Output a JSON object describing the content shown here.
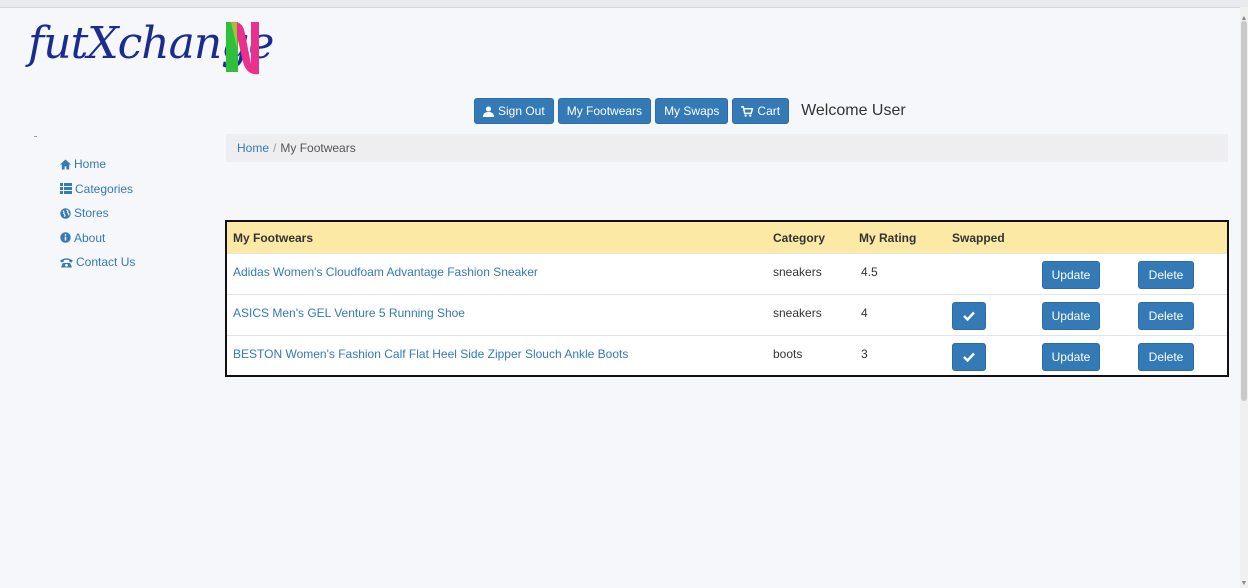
{
  "brand": {
    "logo_text": "futXchange",
    "accent_pink": "#e8308c",
    "accent_green": "#2fbf3a",
    "logo_blue": "#1b2c8f"
  },
  "nav": {
    "sign_out": "Sign Out",
    "my_footwears": "My Footwears",
    "my_swaps": "My Swaps",
    "cart": "Cart",
    "welcome": "Welcome User"
  },
  "sidebar": {
    "items": [
      {
        "label": "Home",
        "icon": "home-icon"
      },
      {
        "label": "Categories",
        "icon": "list-icon"
      },
      {
        "label": "Stores",
        "icon": "globe-icon"
      },
      {
        "label": "About",
        "icon": "info-icon"
      },
      {
        "label": "Contact Us",
        "icon": "phone-icon"
      }
    ]
  },
  "breadcrumb": {
    "home": "Home",
    "separator": "/",
    "current": "My Footwears"
  },
  "table": {
    "headers": {
      "name": "My Footwears",
      "category": "Category",
      "rating": "My Rating",
      "swapped": "Swapped"
    },
    "rows": [
      {
        "name": "Adidas Women's Cloudfoam Advantage Fashion Sneaker",
        "category": "sneakers",
        "rating": "4.5",
        "swapped": false
      },
      {
        "name": "ASICS Men's GEL Venture 5 Running Shoe",
        "category": "sneakers",
        "rating": "4",
        "swapped": true
      },
      {
        "name": "BESTON Women's Fashion Calf Flat Heel Side Zipper Slouch Ankle Boots",
        "category": "boots",
        "rating": "3",
        "swapped": true
      }
    ],
    "update_label": "Update",
    "delete_label": "Delete"
  },
  "colors": {
    "primary": "#337ab7",
    "header_bg": "#fde9a6",
    "breadcrumb_bg": "#eeeef1"
  }
}
